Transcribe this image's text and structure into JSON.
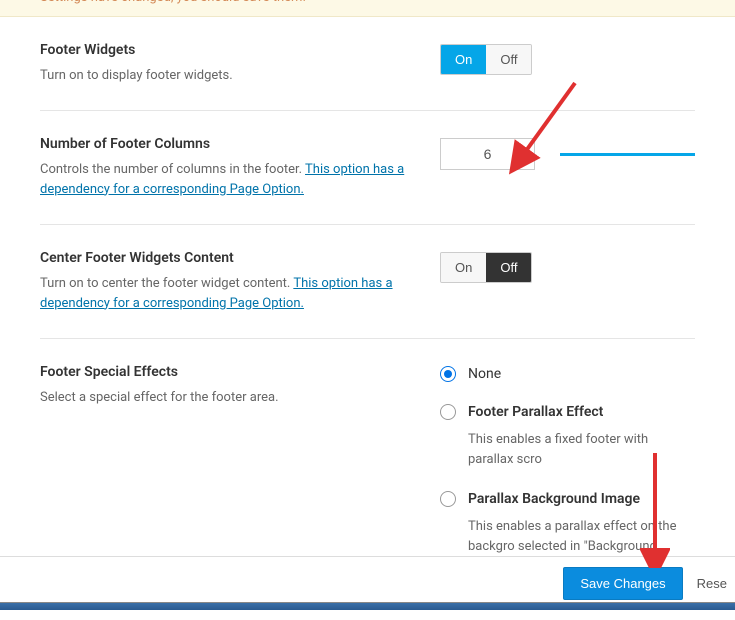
{
  "notice": "Settings have changed, you should save them!",
  "options": {
    "footer_widgets": {
      "title": "Footer Widgets",
      "desc": "Turn on to display footer widgets.",
      "on": "On",
      "off": "Off",
      "value": "on"
    },
    "footer_columns": {
      "title": "Number of Footer Columns",
      "desc_pre": "Controls the number of columns in the footer. ",
      "link": "This option has a dependency for a corresponding Page Option.",
      "value": "6"
    },
    "center_footer": {
      "title": "Center Footer Widgets Content",
      "desc_pre": "Turn on to center the footer widget content. ",
      "link": "This option has a dependency for a corresponding Page Option.",
      "on": "On",
      "off": "Off",
      "value": "off"
    },
    "special_effects": {
      "title": "Footer Special Effects",
      "desc": "Select a special effect for the footer area.",
      "items": [
        {
          "label": "None",
          "checked": true,
          "desc": ""
        },
        {
          "label": "Footer Parallax Effect",
          "checked": false,
          "desc": "This enables a fixed footer with parallax scro"
        },
        {
          "label": "Parallax Background Image",
          "checked": false,
          "desc": "This enables a parallax effect on the backgro selected in \"Background Image For Footer W"
        }
      ]
    }
  },
  "buttons": {
    "save": "Save Changes",
    "reset": "Rese"
  }
}
